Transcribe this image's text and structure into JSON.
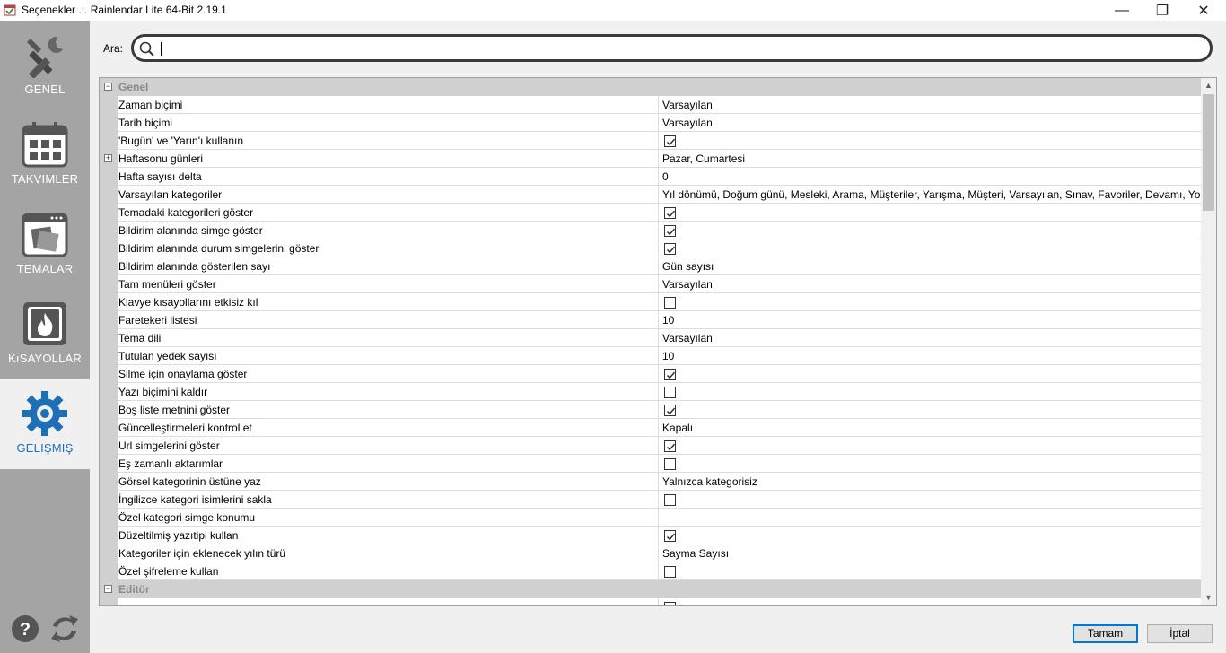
{
  "window": {
    "title": "Seçenekler .:. Rainlendar Lite 64-Bit 2.19.1",
    "minimize_glyph": "—",
    "maximize_glyph": "❐",
    "close_glyph": "✕"
  },
  "sidebar": {
    "items": [
      {
        "label": "GENEL",
        "icon": "tools-icon"
      },
      {
        "label": "TAKVIMLER",
        "icon": "calendar-icon"
      },
      {
        "label": "TEMALAR",
        "icon": "themes-icon"
      },
      {
        "label": "KıSAYOLLAR",
        "icon": "shortcuts-icon"
      },
      {
        "label": "GELIŞMIŞ",
        "icon": "gear-icon"
      }
    ],
    "active": "GELIŞMIŞ",
    "bottom_icons": [
      "help-icon",
      "refresh-icon"
    ]
  },
  "search": {
    "label": "Ara:",
    "value": ""
  },
  "categories": {
    "general": "Genel",
    "editor": "Editör"
  },
  "rows": [
    {
      "key": "Zaman biçimi",
      "value": "Varsayılan"
    },
    {
      "key": "Tarih biçimi",
      "value": "Varsayılan"
    },
    {
      "key": "'Bugün' ve 'Yarın'ı kullanın",
      "checked": true
    },
    {
      "key": "Haftasonu günleri",
      "value": "Pazar, Cumartesi"
    },
    {
      "key": "Hafta sayısı delta",
      "value": "0"
    },
    {
      "key": "Varsayılan kategoriler",
      "value": "Yıl dönümü, Doğum günü, Mesleki, Arama, Müşteriler, Yarışma, Müşteri, Varsayılan, Sınav, Favoriler, Devamı, Your"
    },
    {
      "key": "Temadaki kategorileri göster",
      "checked": true
    },
    {
      "key": "Bildirim alanında simge göster",
      "checked": true
    },
    {
      "key": "Bildirim alanında durum simgelerini göster",
      "checked": true
    },
    {
      "key": "Bildirim alanında gösterilen sayı",
      "value": "Gün sayısı"
    },
    {
      "key": "Tam menüleri göster",
      "value": "Varsayılan"
    },
    {
      "key": "Klavye kısayollarını etkisiz kıl",
      "checked": false
    },
    {
      "key": "Faretekeri listesi",
      "value": "10"
    },
    {
      "key": "Tema dili",
      "value": "Varsayılan"
    },
    {
      "key": "Tutulan yedek sayısı",
      "value": "10"
    },
    {
      "key": "Silme için onaylama göster",
      "checked": true
    },
    {
      "key": "Yazı biçimini kaldır",
      "checked": false
    },
    {
      "key": "Boş liste metnini göster",
      "checked": true
    },
    {
      "key": "Güncelleştirmeleri kontrol et",
      "value": "Kapalı"
    },
    {
      "key": "Url simgelerini göster",
      "checked": true
    },
    {
      "key": "Eş zamanlı aktarımlar",
      "checked": false
    },
    {
      "key": "Görsel kategorinin üstüne yaz",
      "value": "Yalnızca kategorisiz"
    },
    {
      "key": "İngilizce kategori isimlerini sakla",
      "checked": false
    },
    {
      "key": "Özel kategori simge konumu",
      "value": ""
    },
    {
      "key": "Düzeltilmiş yazıtipi kullan",
      "checked": true
    },
    {
      "key": "Kategoriler için eklenecek yılın türü",
      "value": "Sayma Sayısı"
    },
    {
      "key": "Özel şifreleme kullan",
      "checked": false
    }
  ],
  "buttons": {
    "ok": "Tamam",
    "cancel": "İptal"
  }
}
